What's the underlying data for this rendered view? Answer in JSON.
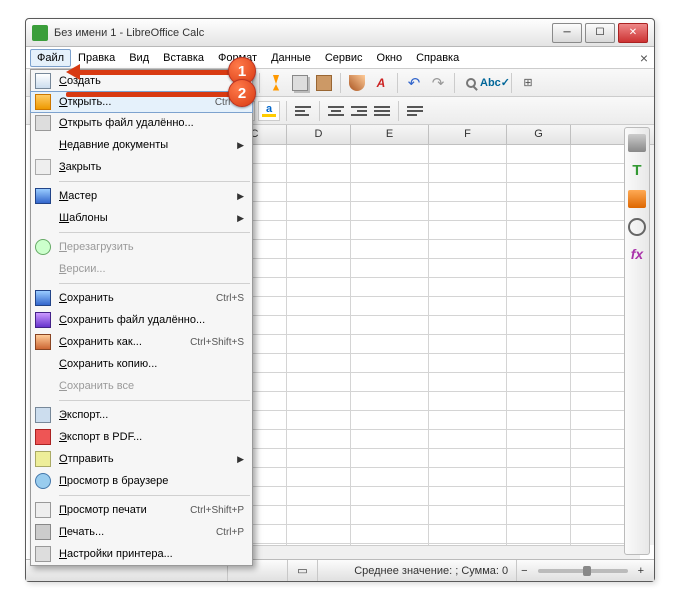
{
  "window": {
    "title": "Без имени 1 - LibreOffice Calc"
  },
  "menubar": [
    "Файл",
    "Правка",
    "Вид",
    "Вставка",
    "Формат",
    "Данные",
    "Сервис",
    "Окно",
    "Справка"
  ],
  "columns": [
    "C",
    "D",
    "E",
    "F",
    "G"
  ],
  "dropdown": [
    {
      "icon": "doc",
      "label": "Создать",
      "arrow": true
    },
    {
      "icon": "open",
      "label": "Открыть...",
      "shortcut": "Ctrl+O",
      "hover": true
    },
    {
      "icon": "remote",
      "label": "Открыть файл удалённо..."
    },
    {
      "icon": "",
      "label": "Недавние документы",
      "arrow": true
    },
    {
      "icon": "close",
      "label": "Закрыть"
    },
    {
      "sep": true
    },
    {
      "icon": "wizard",
      "label": "Мастер",
      "arrow": true
    },
    {
      "icon": "",
      "label": "Шаблоны",
      "arrow": true
    },
    {
      "sep": true
    },
    {
      "icon": "reload",
      "label": "Перезагрузить",
      "disabled": true
    },
    {
      "icon": "",
      "label": "Версии...",
      "disabled": true
    },
    {
      "sep": true
    },
    {
      "icon": "save",
      "label": "Сохранить",
      "shortcut": "Ctrl+S"
    },
    {
      "icon": "saver",
      "label": "Сохранить файл удалённо..."
    },
    {
      "icon": "saveas",
      "label": "Сохранить как...",
      "shortcut": "Ctrl+Shift+S"
    },
    {
      "icon": "",
      "label": "Сохранить копию..."
    },
    {
      "icon": "",
      "label": "Сохранить все",
      "disabled": true
    },
    {
      "sep": true
    },
    {
      "icon": "export",
      "label": "Экспорт..."
    },
    {
      "icon": "pdf",
      "label": "Экспорт в PDF..."
    },
    {
      "icon": "send",
      "label": "Отправить",
      "arrow": true
    },
    {
      "icon": "browser",
      "label": "Просмотр в браузере"
    },
    {
      "sep": true
    },
    {
      "icon": "preview",
      "label": "Просмотр печати",
      "shortcut": "Ctrl+Shift+P"
    },
    {
      "icon": "print",
      "label": "Печать...",
      "shortcut": "Ctrl+P"
    },
    {
      "icon": "printer",
      "label": "Настройки принтера..."
    }
  ],
  "status": {
    "summary": "Среднее значение: ; Сумма: 0"
  },
  "callouts": {
    "one": "1",
    "two": "2"
  }
}
